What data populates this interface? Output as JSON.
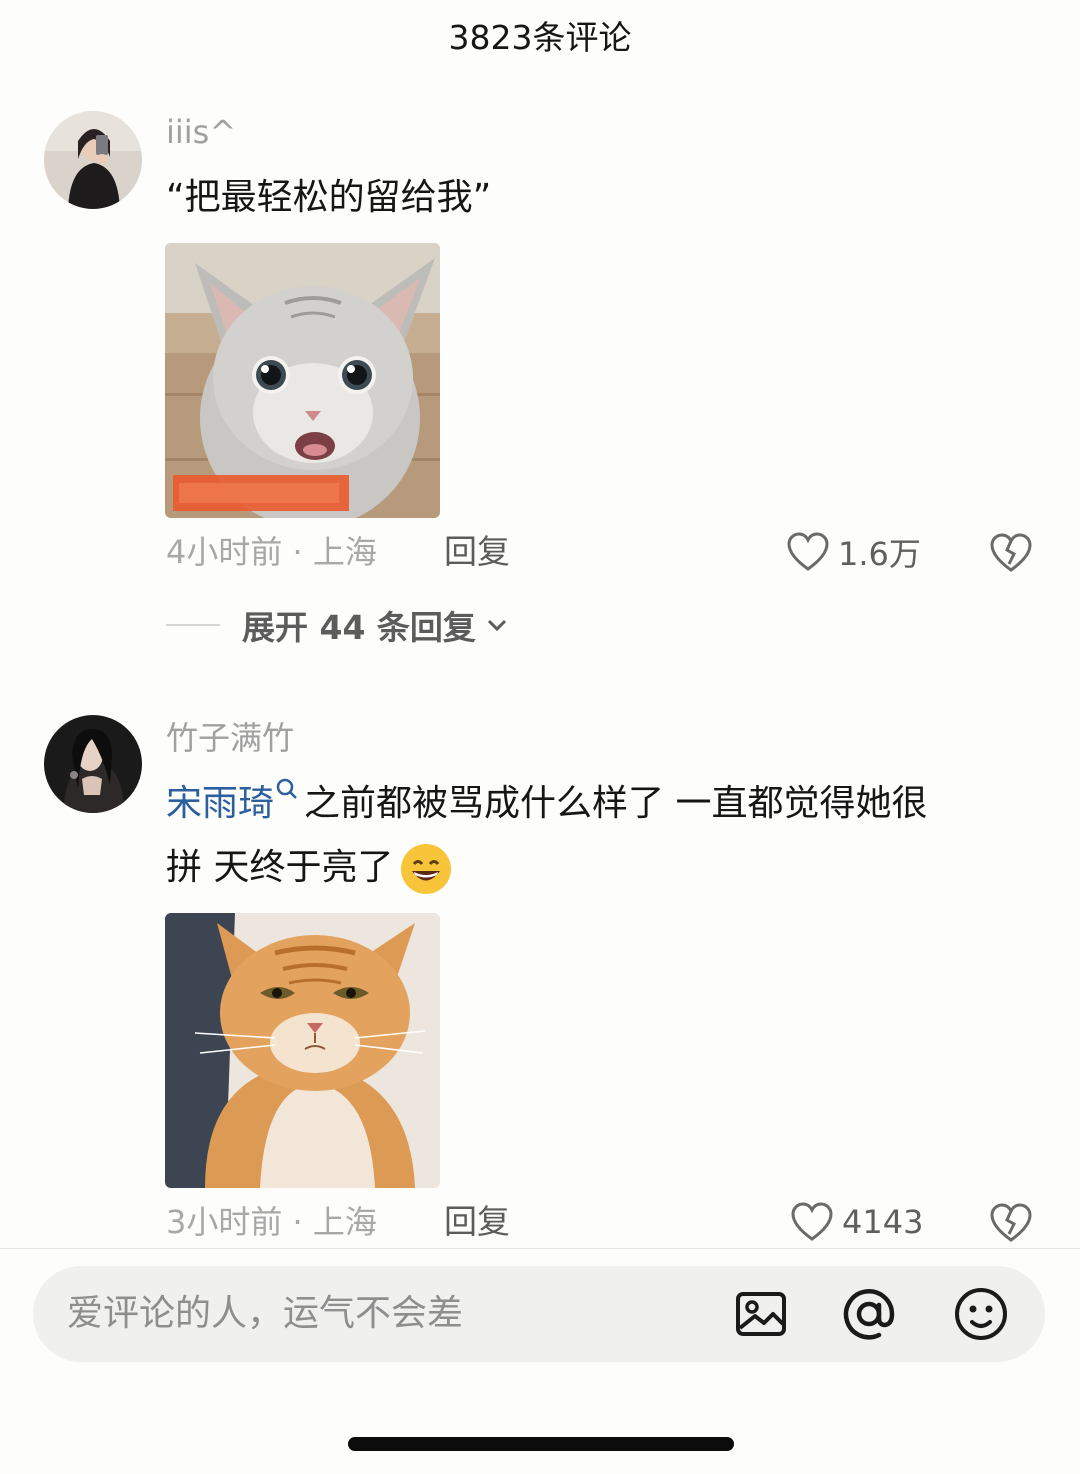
{
  "header": {
    "title": "3823条评论"
  },
  "comments": [
    {
      "username": "iiis^",
      "text": "“把最轻松的留给我”",
      "meta": "4小时前 · 上海",
      "reply_label": "回复",
      "likes": "1.6万",
      "expand_label": "展开 44 条回复",
      "image": "grey-kitten-meme"
    },
    {
      "username": "竹子满竹",
      "mention": "宋雨琦",
      "text_line1": "之前都被骂成什么样了 一直都觉得她很",
      "text_line2": "拼 天终于亮了",
      "meta": "3小时前 · 上海",
      "reply_label": "回复",
      "likes": "4143",
      "image": "orange-cat-meme"
    }
  ],
  "composer": {
    "placeholder": "爱评论的人，运气不会差",
    "icons": [
      "image-icon",
      "at-icon",
      "emoji-icon"
    ]
  },
  "colors": {
    "mention": "#2b5f9d",
    "background": "#fdfdfb"
  }
}
